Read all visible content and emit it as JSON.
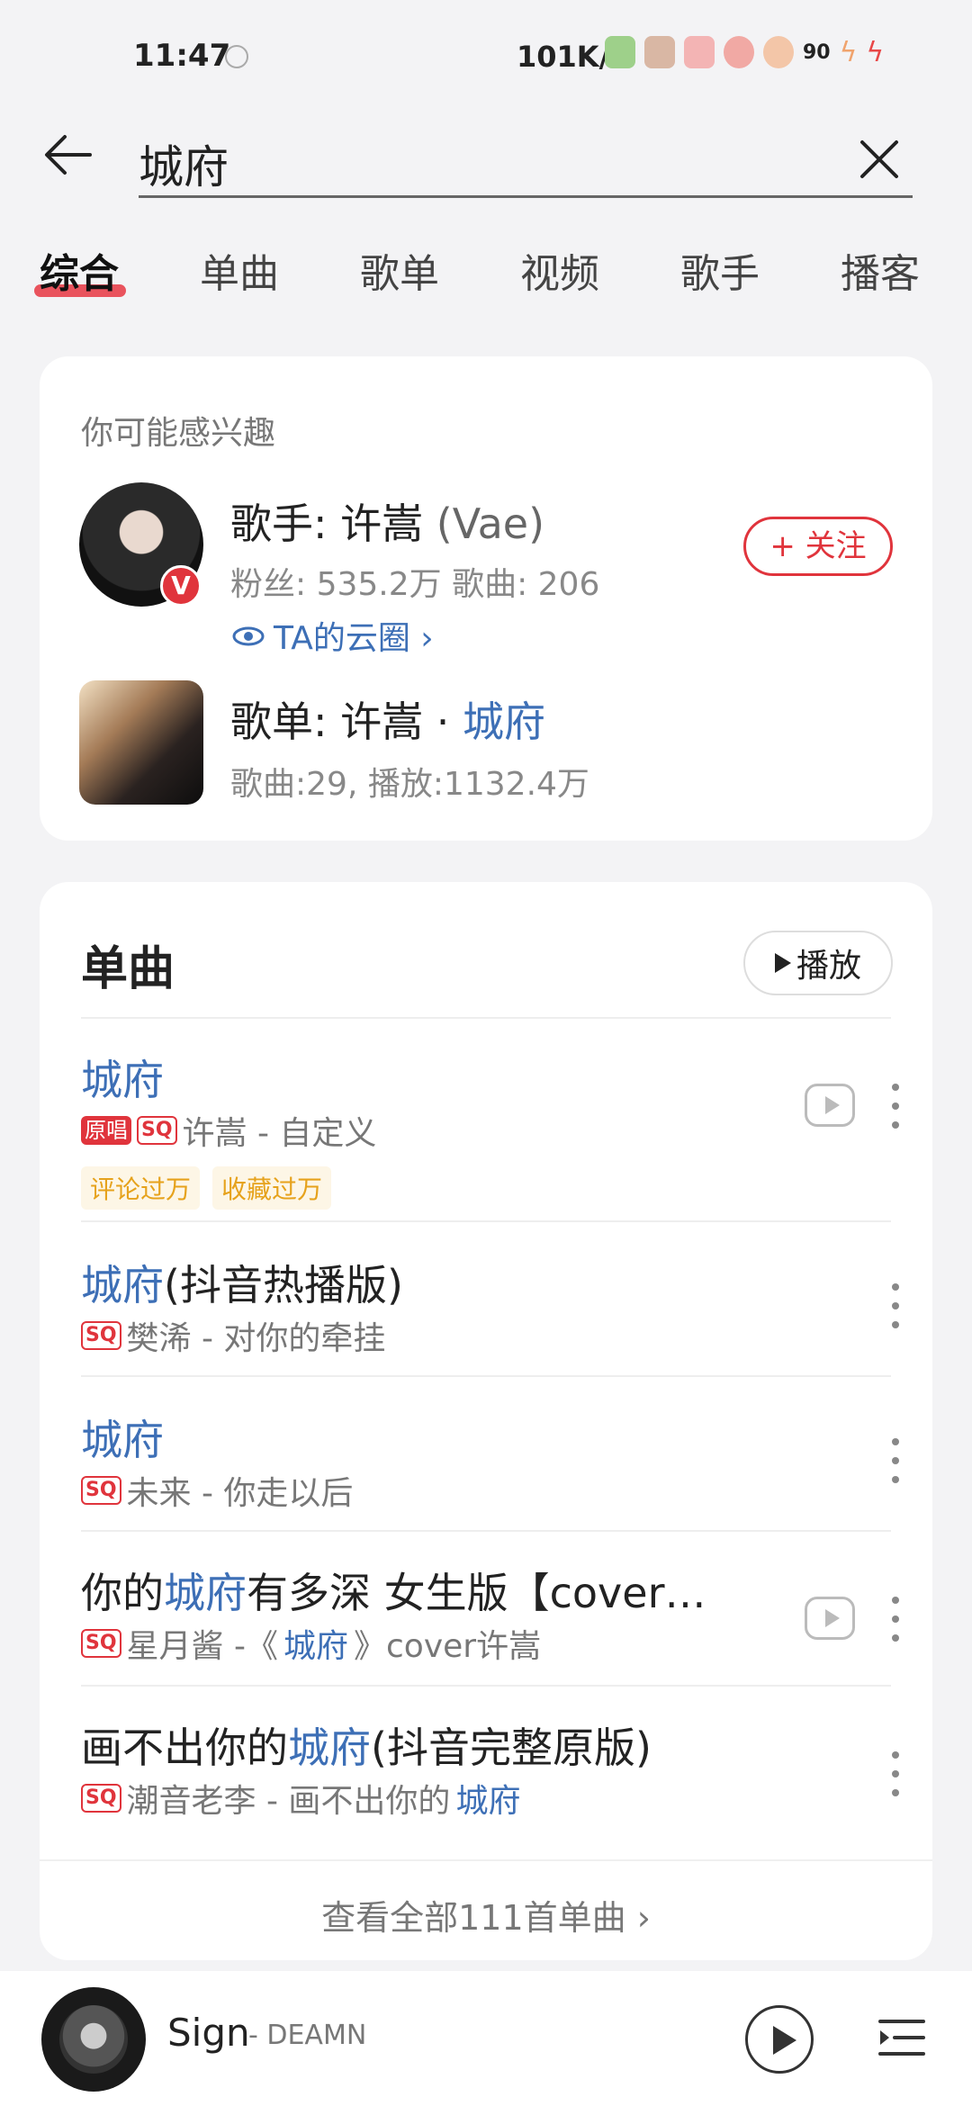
{
  "status_bar": {
    "time": "11:47",
    "speed": "101K/s",
    "battery": "90"
  },
  "search": {
    "query": "城府"
  },
  "tabs": [
    {
      "label": "综合"
    },
    {
      "label": "单曲"
    },
    {
      "label": "歌单"
    },
    {
      "label": "视频"
    },
    {
      "label": "歌手"
    },
    {
      "label": "播客"
    }
  ],
  "interest": {
    "title": "你可能感兴趣",
    "artist": {
      "prefix": "歌手: 许嵩",
      "alias": "(Vae)",
      "stats": "粉丝: 535.2万 歌曲: 206",
      "cloud_link": "TA的云圈 ›",
      "verified_badge": "V",
      "follow_label": "+ 关注"
    },
    "playlist": {
      "prefix": "歌单: 许嵩 · ",
      "highlight": "城府",
      "stats": "歌曲:29, 播放:1132.4万"
    }
  },
  "songs": {
    "header": "单曲",
    "play_label": "播放",
    "items": [
      {
        "title_pre": "",
        "title_hl": "城府",
        "title_post": "",
        "tag_orig": "原唱",
        "tag_sq": "SQ",
        "sub_pre": "许嵩 - 自定义",
        "sub_hl": "",
        "sub_post": "",
        "badges": [
          "评论过万",
          "收藏过万"
        ],
        "has_mv": true
      },
      {
        "title_pre": "",
        "title_hl": "城府",
        "title_post": "(抖音热播版)",
        "tag_sq": "SQ",
        "sub_pre": "樊浠 - 对你的牵挂",
        "sub_hl": "",
        "sub_post": "",
        "has_mv": false
      },
      {
        "title_pre": "",
        "title_hl": "城府",
        "title_post": "",
        "tag_sq": "SQ",
        "sub_pre": "未来 - 你走以后",
        "sub_hl": "",
        "sub_post": "",
        "has_mv": false
      },
      {
        "title_pre": "你的",
        "title_hl": "城府",
        "title_post": "有多深 女生版【cover…",
        "tag_sq": "SQ",
        "sub_pre": "星月酱 -《",
        "sub_hl": "城府",
        "sub_post": "》cover许嵩",
        "has_mv": true
      },
      {
        "title_pre": "画不出你的",
        "title_hl": "城府",
        "title_post": "(抖音完整原版)",
        "tag_sq": "SQ",
        "sub_pre": "潮音老李 - 画不出你的",
        "sub_hl": "城府",
        "sub_post": "",
        "has_mv": false
      }
    ],
    "view_all": "查看全部111首单曲 ›"
  },
  "player": {
    "title": "Sign",
    "artist": "- DEAMN"
  },
  "colors": {
    "accent": "#e0343c",
    "highlight": "#3d6fb6"
  }
}
